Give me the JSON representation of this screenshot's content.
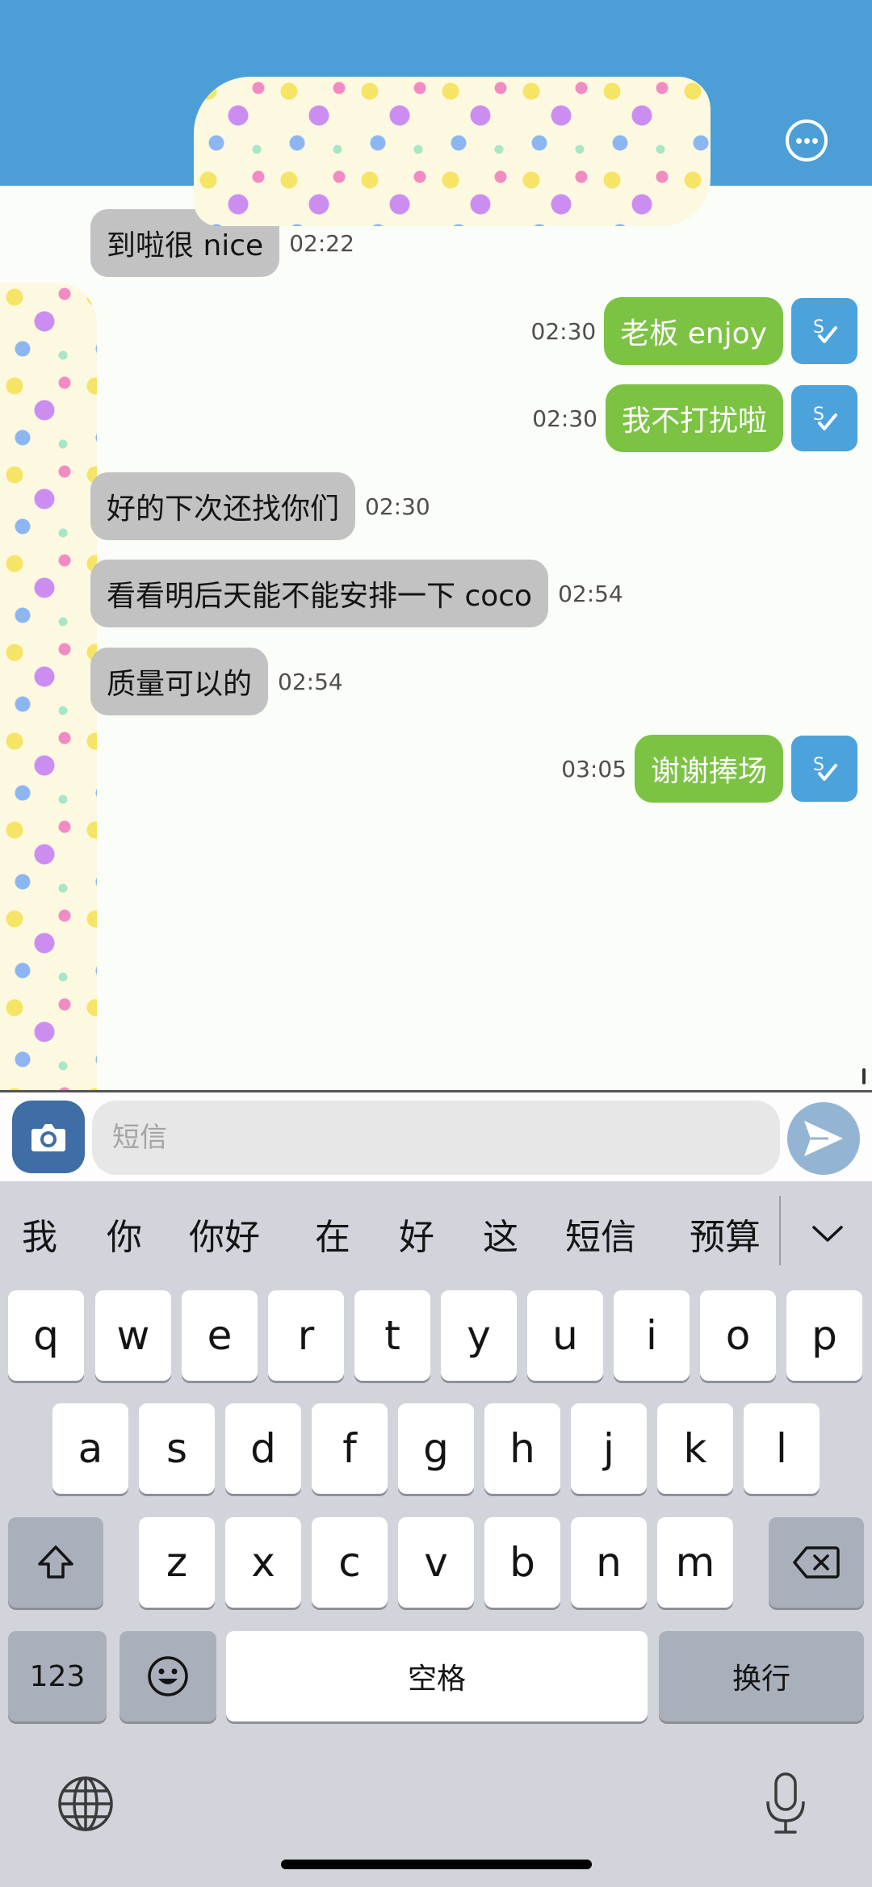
{
  "colors": {
    "header": "#4b9fd6",
    "incoming_bubble": "#c2c2c2",
    "outgoing_bubble": "#7cc243",
    "status_badge": "#4ca2db",
    "keyboard_bg": "#d1d4db"
  },
  "header": {
    "more_icon": "more-circle-icon"
  },
  "messages": [
    {
      "direction": "in",
      "text": "到啦很 nice",
      "time": "02:22"
    },
    {
      "direction": "out",
      "text": "老板 enjoy",
      "time": "02:30"
    },
    {
      "direction": "out",
      "text": "我不打扰啦",
      "time": "02:30"
    },
    {
      "direction": "in",
      "text": "好的下次还找你们",
      "time": "02:30"
    },
    {
      "direction": "in",
      "text": "看看明后天能不能安排一下 coco",
      "time": "02:54"
    },
    {
      "direction": "in",
      "text": "质量可以的",
      "time": "02:54"
    },
    {
      "direction": "out",
      "text": "谢谢捧场",
      "time": "03:05"
    }
  ],
  "composer": {
    "placeholder": "短信",
    "value": "",
    "camera_icon": "camera-icon",
    "send_icon": "send-icon"
  },
  "keyboard": {
    "candidates": [
      "我",
      "你",
      "你好",
      "在",
      "好",
      "这",
      "短信",
      "预算"
    ],
    "row1": [
      "q",
      "w",
      "e",
      "r",
      "t",
      "y",
      "u",
      "i",
      "o",
      "p"
    ],
    "row2": [
      "a",
      "s",
      "d",
      "f",
      "g",
      "h",
      "j",
      "k",
      "l"
    ],
    "row3": [
      "z",
      "x",
      "c",
      "v",
      "b",
      "n",
      "m"
    ],
    "numbers_label": "123",
    "space_label": "空格",
    "return_label": "换行"
  }
}
